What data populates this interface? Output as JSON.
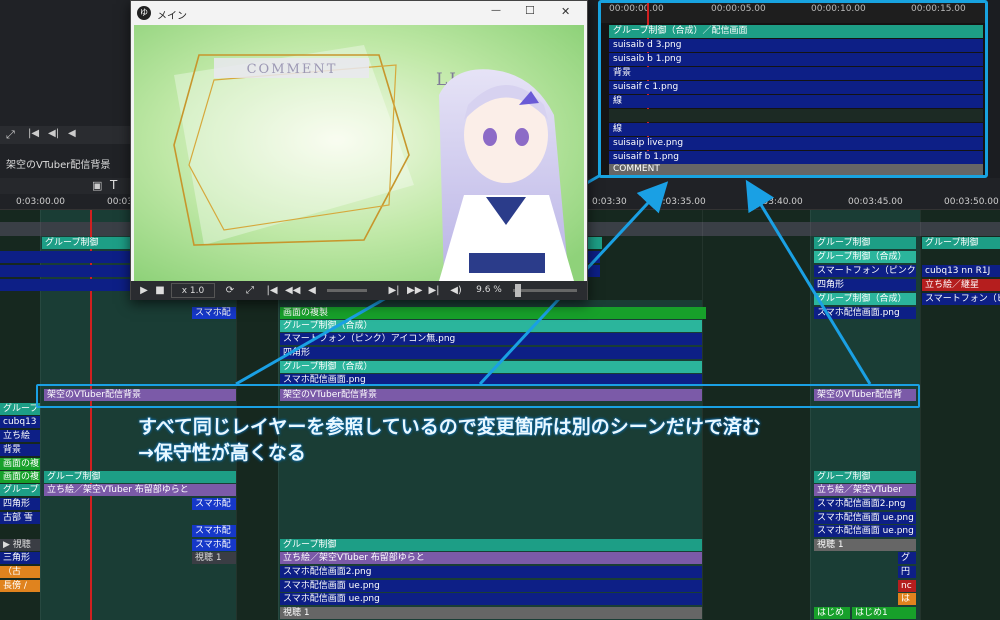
{
  "preview": {
    "title": "メイン",
    "minimize_glyph": "—",
    "maximize_glyph": "☐",
    "close_glyph": "✕",
    "comment_label": "COMMENT",
    "live_label": "LIvE",
    "speed": "x 1.0",
    "zoom_percent": "9.6 %"
  },
  "left": {
    "scene_tab": "架空のVTuber配信背景",
    "text_tool": "T"
  },
  "ruler": {
    "ticks": [
      "0:03:00.00",
      "00:03",
      "0:03:30",
      "00:03:35.00",
      "00:03:40.00",
      "00:03:45.00",
      "00:03:50.00"
    ]
  },
  "zoom": {
    "ruler_ticks": [
      "00:00:00.00",
      "00:00:05.00",
      "00:00:10.00",
      "00:00:15.00"
    ],
    "rows": [
      "グループ制御（合成）／配信画面",
      "suisaib d 3.png",
      "suisaib b 1.png",
      "背景",
      "suisaif c 1.png",
      "線",
      "",
      "線",
      "suisaip live.png",
      "suisaif b 1.png",
      "COMMENT"
    ]
  },
  "clips": {
    "group_a": "グループ制御",
    "dup": "画面の複製",
    "group_comp": "グループ制御（合成）",
    "smartphone_pink": "スマートフォン（ピンク）アイコン無.png",
    "square": "四角形",
    "group_comp2": "グループ制御（合成）",
    "smaho_screen": "スマホ配信画面.png",
    "bg_scene": "架空のVTuber配信背景",
    "bg_scene_small": "架空のVTuber配信背景",
    "bg_scene_right": "架空のVTuber配信背",
    "smaho_short": "スマホ配",
    "group_b": "グループ制御",
    "tachie": "立ち絵／架空VTuber 布留部ゆらと",
    "smaho2": "スマホ配信画面2.png",
    "smaho_ue": "スマホ配信画面 ue.png",
    "smaho_ue2": "スマホ配信画面 ue.png",
    "shichou": "視聴 1",
    "r_group": "グループ制御",
    "r_group2": "グループ制御",
    "r_group_comp": "グループ制御（合成）",
    "r_smartphone": "スマートフォン（ピンク）",
    "r_cubq": "cubq13 nn R1J",
    "r_square": "四角形",
    "r_tachie_short": "立ち絵／継星",
    "r_group_comp2": "グループ制御（合成）",
    "r_smartphone2": "スマートフォン（ピ",
    "r_smaho": "スマホ配信画面.png",
    "r_group3": "グループ制御",
    "r_tachie": "立ち絵／架空VTuber",
    "r_smaho2": "スマホ配信画面2.png",
    "r_smaho_ue": "スマホ配信画面 ue.png",
    "r_smaho_ue2": "スマホ配信画面 ue.png",
    "r_shichou": "視聴 1",
    "r_gu": "グ",
    "r_en": "円",
    "r_nc": "nc",
    "r_ha": "は",
    "r_hajime": "はじめ",
    "r_hajime2": "はじめ1",
    "l_group": "グルーブ",
    "l_cubq": "cubq13",
    "l_tachie": "立ち絵",
    "l_haikei": "背景",
    "l_dup": "画面の複",
    "l_dup2": "画面の複",
    "l_group2": "グループ",
    "l_square": "四角形",
    "l_ko": "古部 雪",
    "l_shichou": "▶ 視聴",
    "l_sankaku": "三角形",
    "l_furu": "（古",
    "l_chou": "長傍 /",
    "l_group3": "グループ制御",
    "l_tachie2": "立ち絵／架空VTuber 布留部ゆらと",
    "l_smaho_a": "スマホ配",
    "l_smaho_b": "スマホ配",
    "l_smaho_c": "スマホ配",
    "l_shichou2": "視聴 1"
  },
  "note": {
    "line1": "すべて同じレイヤーを参照しているので変更箇所は別のシーンだけで済む",
    "line2": "→保守性が高くなる"
  }
}
